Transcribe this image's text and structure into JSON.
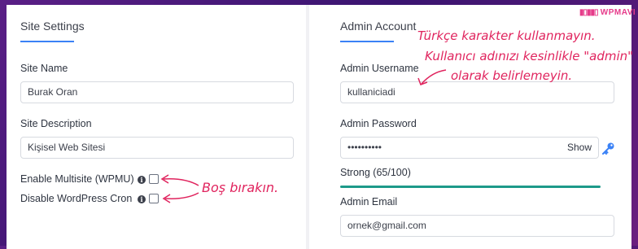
{
  "brand": {
    "logo_text": "WPMAVI"
  },
  "site_settings": {
    "title": "Site Settings",
    "site_name_label": "Site Name",
    "site_name_value": "Burak Oran",
    "site_description_label": "Site Description",
    "site_description_value": "Kişisel Web Sitesi",
    "multisite_label": "Enable Multisite (WPMU)",
    "cron_label": "Disable WordPress Cron",
    "multisite_checked": false,
    "cron_checked": false
  },
  "admin_account": {
    "title": "Admin Account",
    "username_label": "Admin Username",
    "username_value": "kullaniciadi",
    "password_label": "Admin Password",
    "password_value": "••••••••••",
    "show_label": "Show",
    "strength_text": "Strong (65/100)",
    "strength_percent": 65,
    "email_label": "Admin Email",
    "email_value": "ornek@gmail.com"
  },
  "annotations": {
    "username_note_line1": "Türkçe karakter kullanmayın.",
    "username_note_line2": "Kullanıcı adınızı kesinlikle \"admin\"",
    "username_note_line3": "olarak belirlemeyin.",
    "checkbox_note": "Boş bırakın."
  },
  "colors": {
    "accent": "#3b82f6",
    "strength": "#1d9a8a",
    "annotation": "#e0245e"
  },
  "icons": {
    "info": "info-icon",
    "key": "key-icon"
  }
}
